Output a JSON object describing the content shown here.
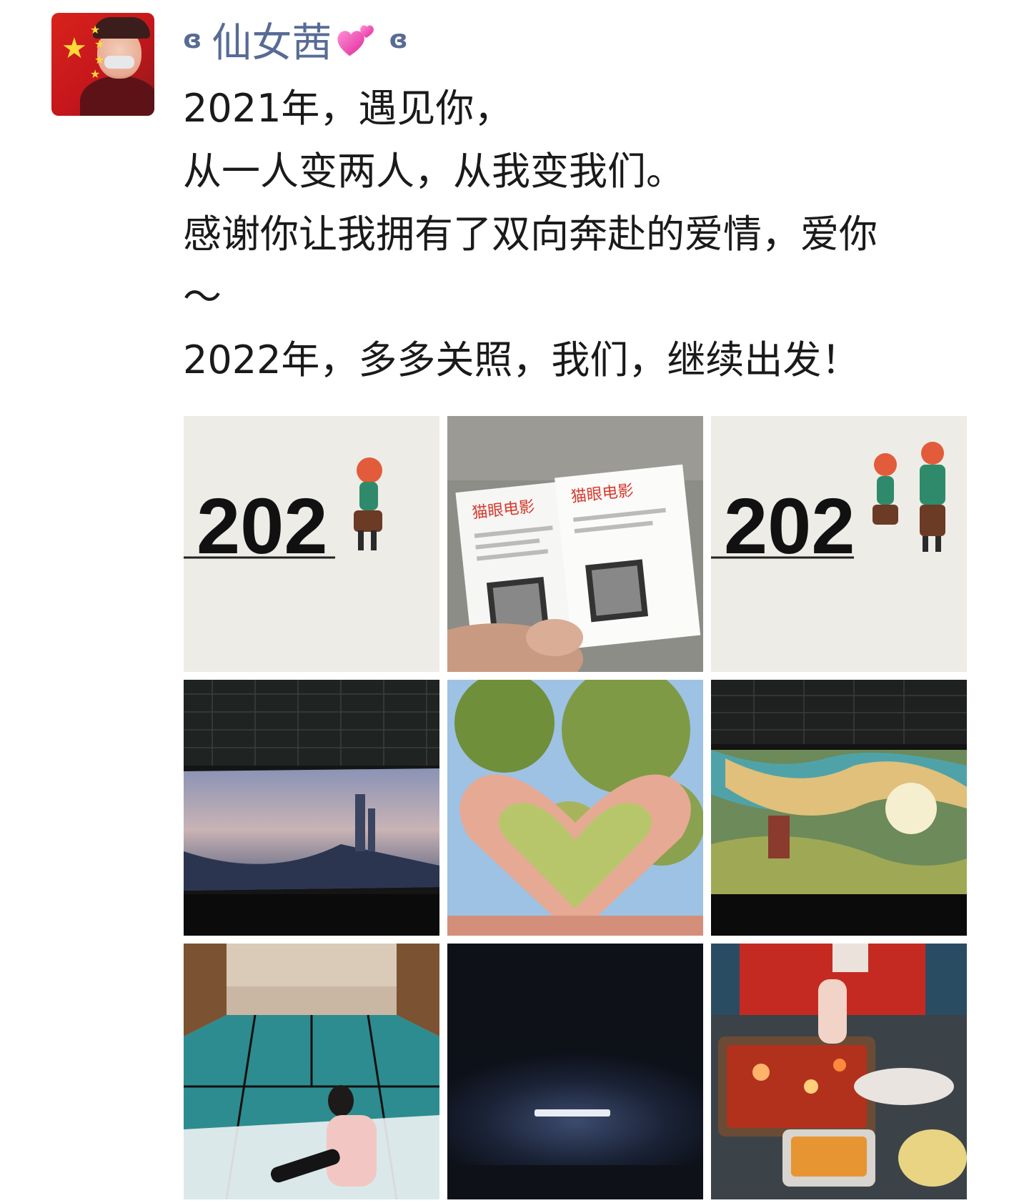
{
  "post": {
    "author": {
      "nickname": "仙女茜",
      "decor_left": "ɞ",
      "decor_right": "ɞ",
      "name_color": "#576b95",
      "emoji": "two-hearts-icon"
    },
    "text_lines": [
      "2021年，遇见你，",
      "从一人变两人，从我变我们。",
      "感谢你让我拥有了双向奔赴的爱情，爱你",
      "～",
      "2022年，多多关照，我们，继续出发！"
    ],
    "photos": [
      {
        "name": "photo-2022-illustration-single",
        "caption": "202"
      },
      {
        "name": "photo-movie-tickets",
        "caption": "猫眼电影"
      },
      {
        "name": "photo-2022-illustration-couple",
        "caption": "202"
      },
      {
        "name": "photo-cinema-city-screen",
        "caption": ""
      },
      {
        "name": "photo-hand-heart",
        "caption": ""
      },
      {
        "name": "photo-cinema-animated-screen",
        "caption": ""
      },
      {
        "name": "photo-girl-window",
        "caption": ""
      },
      {
        "name": "photo-dark-screen",
        "caption": ""
      },
      {
        "name": "photo-grilled-fish-meal",
        "caption": ""
      }
    ]
  }
}
